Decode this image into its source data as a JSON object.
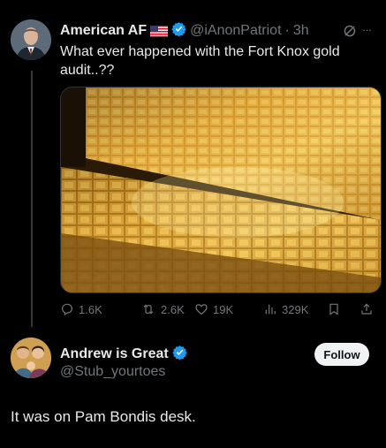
{
  "tweet": {
    "author_name": "American AF",
    "flag_emoji": "🇺🇸",
    "handle": "@iAnonPatriot",
    "separator": "·",
    "time": "3h",
    "more_symbol": "···",
    "text_line1": "What ever happened with the Fort Knox gold",
    "text_line2": "audit..??",
    "stats": {
      "replies": "1.6K",
      "retweets": "2.6K",
      "likes": "19K",
      "views": "329K"
    }
  },
  "reply": {
    "author_name": "Andrew is Great",
    "handle": "@Stub_yourtoes",
    "follow_label": "Follow",
    "text": "It was on Pam Bondis desk."
  },
  "colors": {
    "background": "#000000",
    "text": "#e7e9ea",
    "muted": "#71767b",
    "verified": "#1d9bf0",
    "gold": "#d8a12c"
  }
}
